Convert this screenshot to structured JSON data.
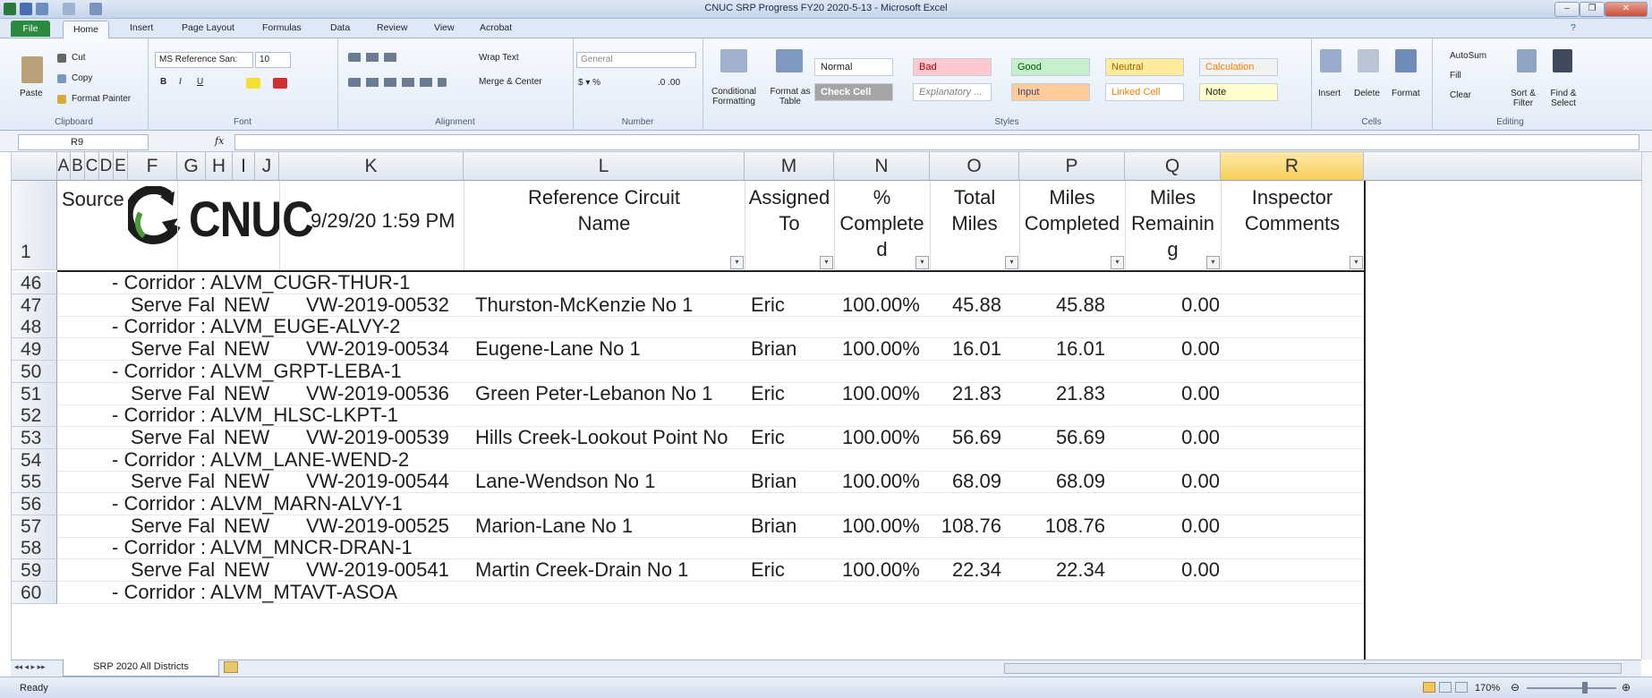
{
  "window": {
    "title": "CNUC SRP Progress FY20 2020-5-13 - Microsoft Excel"
  },
  "ribbon_tabs": [
    "File",
    "Home",
    "Insert",
    "Page Layout",
    "Formulas",
    "Data",
    "Review",
    "View",
    "Acrobat"
  ],
  "clipboard": {
    "paste": "Paste",
    "cut": "Cut",
    "copy": "Copy",
    "format_painter": "Format Painter",
    "label": "Clipboard"
  },
  "font": {
    "name": "MS Reference San:",
    "size": "10",
    "label": "Font"
  },
  "alignment": {
    "wrap": "Wrap Text",
    "merge": "Merge & Center",
    "label": "Alignment"
  },
  "number": {
    "format": "General",
    "label": "Number"
  },
  "styles": {
    "conditional": "Conditional Formatting",
    "format_table": "Format as Table",
    "cells_row1": [
      "Normal",
      "Bad",
      "Good",
      "Neutral",
      "Calculation"
    ],
    "cells_row2": [
      "Check Cell",
      "Explanatory ...",
      "Input",
      "Linked Cell",
      "Note"
    ],
    "label": "Styles"
  },
  "cells_group": {
    "insert": "Insert",
    "delete": "Delete",
    "format": "Format",
    "label": "Cells"
  },
  "editing": {
    "autosum": "AutoSum",
    "fill": "Fill",
    "clear": "Clear",
    "sort": "Sort & Filter",
    "find": "Find & Select",
    "label": "Editing"
  },
  "formula_bar": {
    "name_box": "R9",
    "fx": "fx"
  },
  "columns": [
    "A",
    "B",
    "C",
    "D",
    "E",
    "F",
    "G",
    "H",
    "I",
    "J",
    "K",
    "L",
    "M",
    "N",
    "O",
    "P",
    "Q",
    "R"
  ],
  "header_row": {
    "row_num": "1",
    "source": "Source",
    "logo_text": "CNUC",
    "timestamp": "9/29/20 1:59 PM",
    "ref_line1": "Reference Circuit",
    "ref_line2": "Name",
    "assigned_line1": "Assigned",
    "assigned_line2": "To",
    "pct_line1": "%",
    "pct_line2": "Complete",
    "pct_line3": "d",
    "total_line1": "Total",
    "total_line2": "Miles",
    "done_line1": "Miles",
    "done_line2": "Completed",
    "remain_line1": "Miles",
    "remain_line2": "Remainin",
    "remain_line3": "g",
    "insp_line1": "Inspector",
    "insp_line2": "Comments"
  },
  "rows": [
    {
      "num": "46",
      "type": "corridor",
      "text": "- Corridor : ALVM_CUGR-THUR-1"
    },
    {
      "num": "47",
      "type": "data",
      "src": "Serve Fal",
      "status": "NEW",
      "id": "VW-2019-00532",
      "name": "Thurston-McKenzie No 1",
      "assigned": "Eric",
      "pct": "100.00%",
      "total": "45.88",
      "done": "45.88",
      "remain": "0.00"
    },
    {
      "num": "48",
      "type": "corridor",
      "text": "- Corridor : ALVM_EUGE-ALVY-2"
    },
    {
      "num": "49",
      "type": "data",
      "src": "Serve Fal",
      "status": "NEW",
      "id": "VW-2019-00534",
      "name": "Eugene-Lane No 1",
      "assigned": "Brian",
      "pct": "100.00%",
      "total": "16.01",
      "done": "16.01",
      "remain": "0.00"
    },
    {
      "num": "50",
      "type": "corridor",
      "text": "- Corridor : ALVM_GRPT-LEBA-1"
    },
    {
      "num": "51",
      "type": "data",
      "src": "Serve Fal",
      "status": "NEW",
      "id": "VW-2019-00536",
      "name": "Green Peter-Lebanon No 1",
      "assigned": "Eric",
      "pct": "100.00%",
      "total": "21.83",
      "done": "21.83",
      "remain": "0.00"
    },
    {
      "num": "52",
      "type": "corridor",
      "text": "- Corridor : ALVM_HLSC-LKPT-1"
    },
    {
      "num": "53",
      "type": "data",
      "src": "Serve Fal",
      "status": "NEW",
      "id": "VW-2019-00539",
      "name": "Hills Creek-Lookout Point No",
      "assigned": "Eric",
      "pct": "100.00%",
      "total": "56.69",
      "done": "56.69",
      "remain": "0.00"
    },
    {
      "num": "54",
      "type": "corridor",
      "text": "- Corridor : ALVM_LANE-WEND-2"
    },
    {
      "num": "55",
      "type": "data",
      "src": "Serve Fal",
      "status": "NEW",
      "id": "VW-2019-00544",
      "name": "Lane-Wendson No 1",
      "assigned": "Brian",
      "pct": "100.00%",
      "total": "68.09",
      "done": "68.09",
      "remain": "0.00"
    },
    {
      "num": "56",
      "type": "corridor",
      "text": "- Corridor : ALVM_MARN-ALVY-1"
    },
    {
      "num": "57",
      "type": "data",
      "src": "Serve Fal",
      "status": "NEW",
      "id": "VW-2019-00525",
      "name": "Marion-Lane No 1",
      "assigned": "Brian",
      "pct": "100.00%",
      "total": "108.76",
      "done": "108.76",
      "remain": "0.00"
    },
    {
      "num": "58",
      "type": "corridor",
      "text": "- Corridor : ALVM_MNCR-DRAN-1"
    },
    {
      "num": "59",
      "type": "data",
      "src": "Serve Fal",
      "status": "NEW",
      "id": "VW-2019-00541",
      "name": "Martin Creek-Drain No 1",
      "assigned": "Eric",
      "pct": "100.00%",
      "total": "22.34",
      "done": "22.34",
      "remain": "0.00"
    },
    {
      "num": "60",
      "type": "corridor",
      "text": "- Corridor : ALVM_MTAVT-ASOA"
    }
  ],
  "sheet_tab": "SRP 2020 All Districts",
  "status": {
    "ready": "Ready",
    "zoom": "170%"
  }
}
